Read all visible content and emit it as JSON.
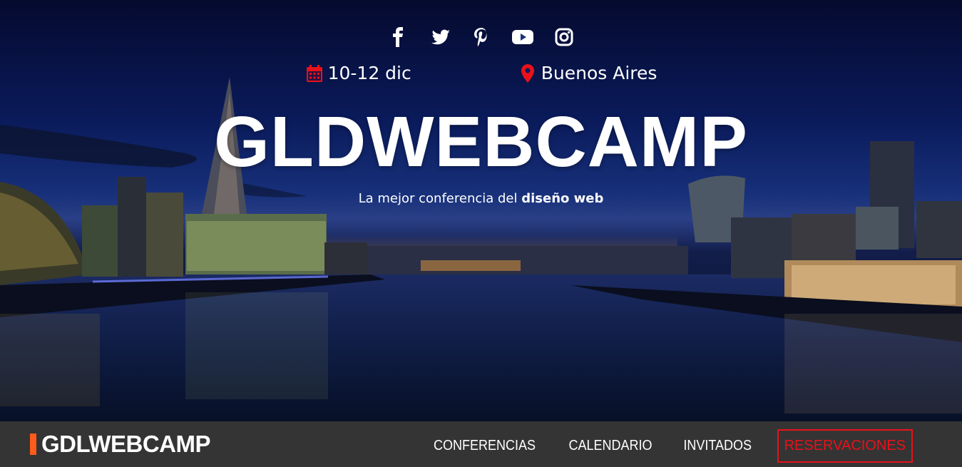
{
  "hero": {
    "socials": [
      {
        "name": "facebook-icon"
      },
      {
        "name": "twitter-icon"
      },
      {
        "name": "pinterest-icon"
      },
      {
        "name": "youtube-icon"
      },
      {
        "name": "instagram-icon"
      }
    ],
    "date": "10-12 dic",
    "location": "Buenos Aires",
    "title": "GLDWEBCAMP",
    "subtitle_prefix": "La mejor conferencia del ",
    "subtitle_bold": "diseño web",
    "accent_color": "#e8111a"
  },
  "navbar": {
    "brand": "GDLWEBCAMP",
    "brand_accent": "#ff5b1a",
    "links": [
      "CONFERENCIAS",
      "CALENDARIO",
      "INVITADOS"
    ],
    "cta": "RESERVACIONES"
  }
}
